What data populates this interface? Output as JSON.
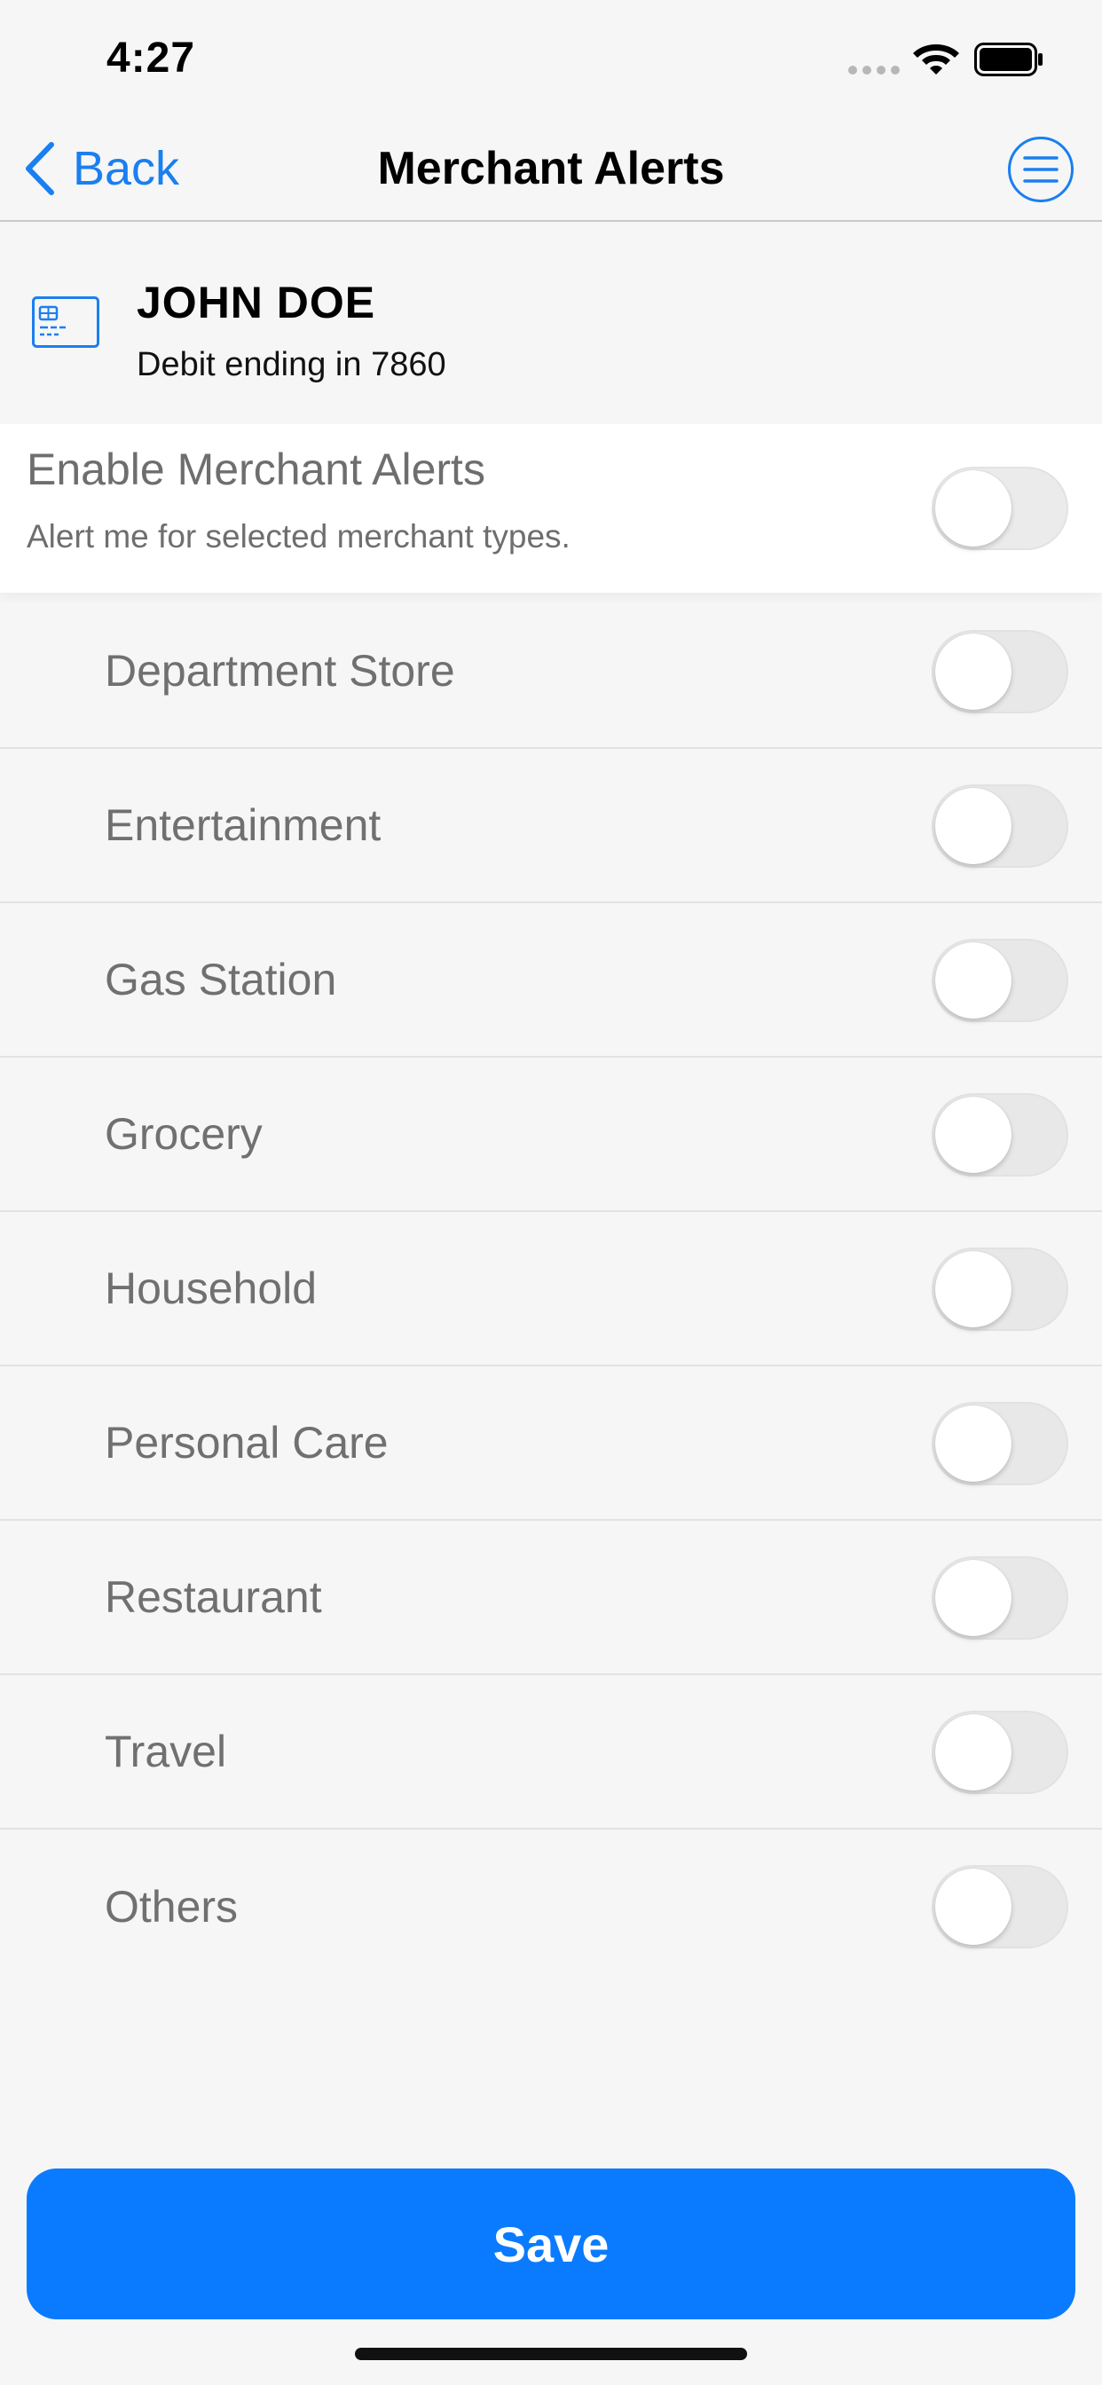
{
  "status_bar": {
    "time": "4:27"
  },
  "nav": {
    "back_label": "Back",
    "title": "Merchant Alerts",
    "menu_icon": "menu-icon"
  },
  "card": {
    "holder_name": "JOHN DOE",
    "subtitle": "Debit ending in 7860",
    "icon": "credit-card-icon"
  },
  "enable": {
    "title": "Enable Merchant Alerts",
    "description": "Alert me for selected merchant types.",
    "enabled": false
  },
  "categories": [
    {
      "label": "Department Store",
      "enabled": false
    },
    {
      "label": "Entertainment",
      "enabled": false
    },
    {
      "label": "Gas Station",
      "enabled": false
    },
    {
      "label": "Grocery",
      "enabled": false
    },
    {
      "label": "Household",
      "enabled": false
    },
    {
      "label": "Personal Care",
      "enabled": false
    },
    {
      "label": "Restaurant",
      "enabled": false
    },
    {
      "label": "Travel",
      "enabled": false
    },
    {
      "label": "Others",
      "enabled": false
    }
  ],
  "actions": {
    "save_label": "Save"
  },
  "colors": {
    "accent": "#0a7bfe",
    "link": "#1a7ff0",
    "background": "#f6f6f6"
  }
}
